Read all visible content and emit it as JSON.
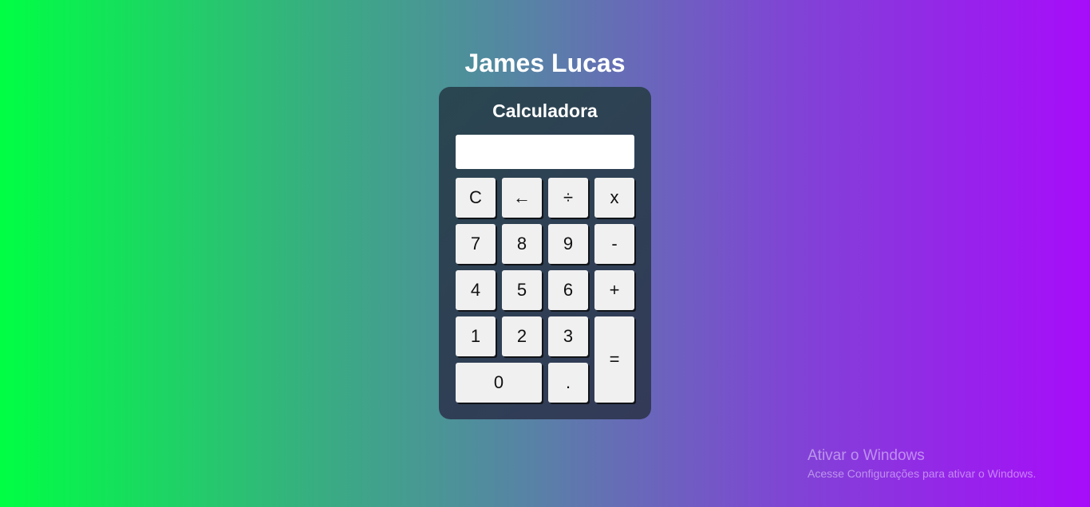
{
  "header": {
    "title": "James Lucas"
  },
  "calculator": {
    "title": "Calculadora",
    "display_value": "",
    "keys": {
      "clear": "C",
      "backspace": "←",
      "divide": "÷",
      "multiply": "x",
      "seven": "7",
      "eight": "8",
      "nine": "9",
      "minus": "-",
      "four": "4",
      "five": "5",
      "six": "6",
      "plus": "+",
      "one": "1",
      "two": "2",
      "three": "3",
      "equals": "=",
      "zero": "0",
      "dot": "."
    }
  },
  "watermark": {
    "title": "Ativar o Windows",
    "subtitle": "Acesse Configurações para ativar o Windows."
  },
  "colors": {
    "gradient_left": "#00ff44",
    "gradient_right": "#a70cfa",
    "panel": "#2f4055",
    "key": "#f0f0f0"
  }
}
